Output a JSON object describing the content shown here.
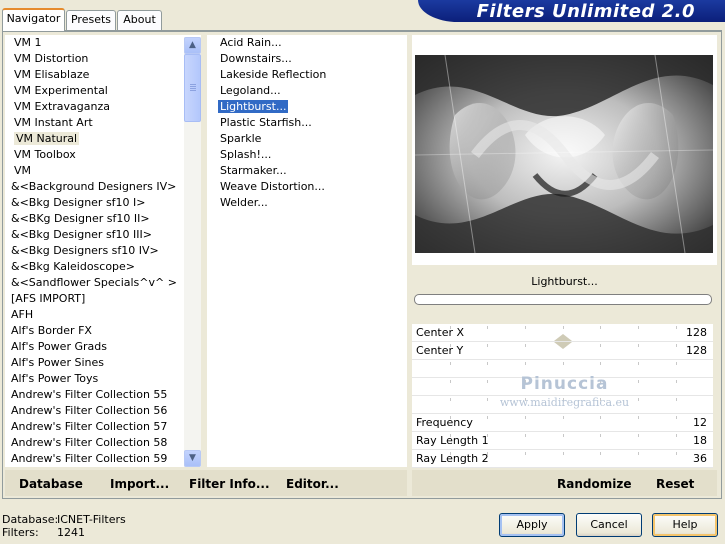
{
  "app": {
    "title": "Filters Unlimited 2.0"
  },
  "tabs": [
    {
      "label": "Navigator",
      "active": true
    },
    {
      "label": "Presets",
      "active": false
    },
    {
      "label": "About",
      "active": false
    }
  ],
  "categories": [
    "VM 1",
    "VM Distortion",
    "VM Elisablaze",
    "VM Experimental",
    "VM Extravaganza",
    "VM Instant Art",
    "VM Natural",
    "VM Toolbox",
    "VM",
    "&<Background Designers IV>",
    "&<Bkg Designer sf10 I>",
    "&<BKg Designer sf10 II>",
    "&<Bkg Designer sf10 III>",
    "&<Bkg Designers sf10 IV>",
    "&<Bkg Kaleidoscope>",
    "&<Sandflower Specials^v^ >",
    "[AFS IMPORT]",
    "AFH",
    "Alf's Border FX",
    "Alf's Power Grads",
    "Alf's Power Sines",
    "Alf's Power Toys",
    "Andrew's Filter Collection 55",
    "Andrew's Filter Collection 56",
    "Andrew's Filter Collection 57",
    "Andrew's Filter Collection 58",
    "Andrew's Filter Collection 59"
  ],
  "selected_category": "VM Natural",
  "filters": [
    "Acid Rain...",
    "Downstairs...",
    "Lakeside Reflection",
    "Legoland...",
    "Lightburst...",
    "Plastic Starfish...",
    "Sparkle",
    "Splash!...",
    "Starmaker...",
    "Weave Distortion...",
    "Welder..."
  ],
  "selected_filter": "Lightburst...",
  "preview": {
    "filter_name": "Lightburst..."
  },
  "params": [
    {
      "label": "Center X",
      "value": "128",
      "level": 0.5
    },
    {
      "label": "Center Y",
      "value": "128",
      "level": 0.5
    },
    {
      "label": "",
      "value": ""
    },
    {
      "label": "",
      "value": ""
    },
    {
      "label": "",
      "value": ""
    },
    {
      "label": "Frequency",
      "value": "12"
    },
    {
      "label": "Ray Length 1",
      "value": "18"
    },
    {
      "label": "Ray Length 2",
      "value": "36"
    }
  ],
  "watermark": {
    "name": "Pinuccia",
    "site": "www.maidiregrafica.eu"
  },
  "links": {
    "database": "Database",
    "import": "Import...",
    "filter_info": "Filter Info...",
    "editor": "Editor...",
    "randomize": "Randomize",
    "reset": "Reset"
  },
  "info": {
    "database_label": "Database:",
    "database_value": "ICNET-Filters",
    "filters_label": "Filters:",
    "filters_value": "1241"
  },
  "buttons": {
    "apply": "Apply",
    "cancel": "Cancel",
    "help": "Help"
  },
  "colors": {
    "selection": "#316ac5",
    "banner": "#0b1f7a",
    "background": "#ece9d8"
  }
}
